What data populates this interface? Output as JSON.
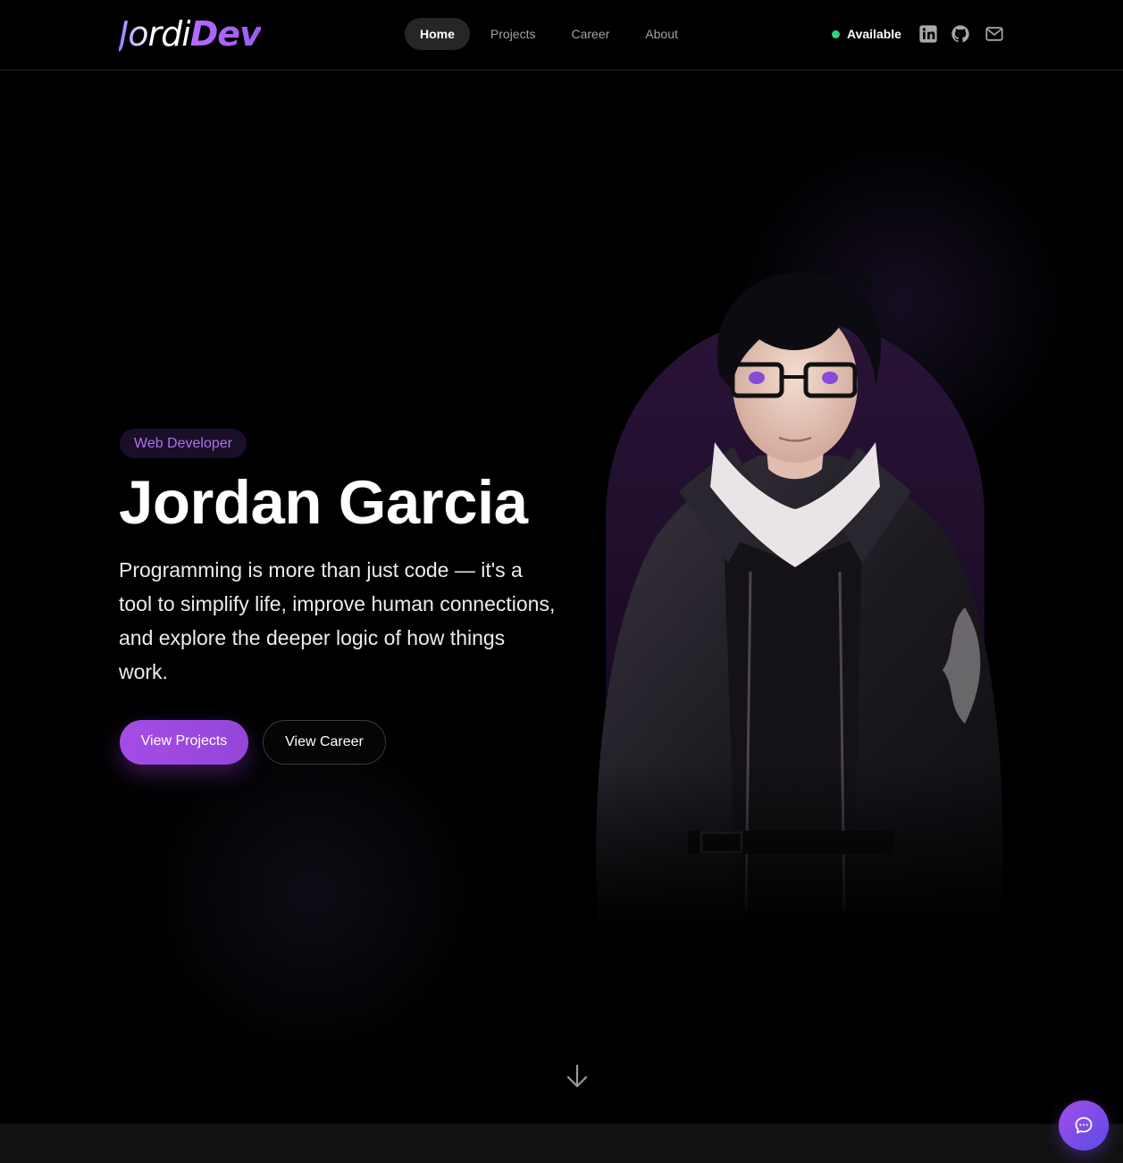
{
  "brand": {
    "logo_part1": "Jordi",
    "logo_part2": "Dev",
    "accent": "#a54ce6"
  },
  "nav": {
    "items": [
      {
        "label": "Home",
        "active": true
      },
      {
        "label": "Projects",
        "active": false
      },
      {
        "label": "Career",
        "active": false
      },
      {
        "label": "About",
        "active": false
      }
    ]
  },
  "status": {
    "label": "Available",
    "color": "#2fd47a"
  },
  "social": {
    "icons": [
      "linkedin-icon",
      "github-icon",
      "mail-icon"
    ]
  },
  "hero": {
    "badge": "Web Developer",
    "name": "Jordan Garcia",
    "tagline": "Programming is more than just code — it's a tool to simplify life, improve human connections, and explore the deeper logic of how things work.",
    "primary_button": "View Projects",
    "secondary_button": "View Career"
  },
  "icons": {
    "scroll": "arrow-down-icon",
    "chat": "chat-bubble-icon"
  }
}
